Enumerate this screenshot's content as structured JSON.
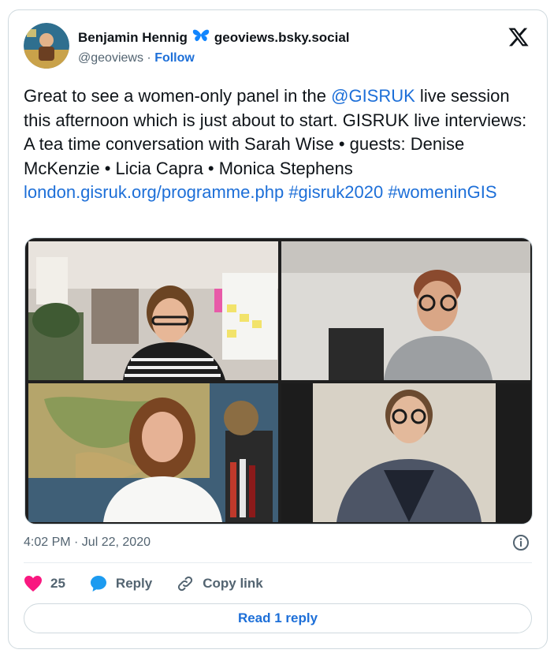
{
  "author": {
    "display_name": "Benjamin Hennig",
    "handle_domain": "geoviews.bsky.social",
    "handle": "@geoviews",
    "separator": "·",
    "follow_label": "Follow",
    "badge_icon": "butterfly-icon"
  },
  "tweet": {
    "segments": [
      {
        "text": "Great to see a women-only panel in the ",
        "link": false
      },
      {
        "text": "@GISRUK",
        "link": true
      },
      {
        "text": " live session this afternoon which is just about to start. GISRUK live interviews: A tea time conversation with Sarah Wise • guests: Denise McKenzie • Licia Capra • Monica Stephens ",
        "link": false
      },
      {
        "text": "london.gisruk.org/programme.php",
        "link": true
      },
      {
        "text": " ",
        "link": false
      },
      {
        "text": "#gisruk2020",
        "link": true
      },
      {
        "text": " ",
        "link": false
      },
      {
        "text": "#womeninGIS",
        "link": true
      }
    ]
  },
  "timestamp": "4:02 PM · Jul 22, 2020",
  "actions": {
    "like_count": "25",
    "reply_label": "Reply",
    "copy_label": "Copy link"
  },
  "read_reply_label": "Read 1 reply",
  "colors": {
    "link": "#1d6fd8",
    "like": "#f91880",
    "reply_icon": "#1d9bf0",
    "muted": "#536471"
  }
}
